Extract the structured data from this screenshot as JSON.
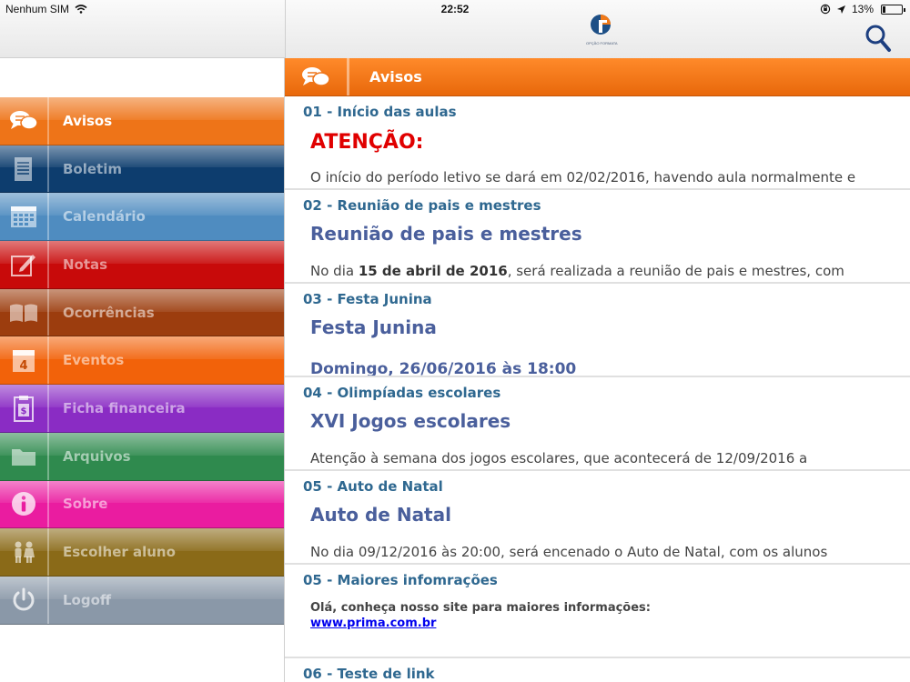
{
  "status_bar": {
    "carrier": "Nenhum SIM",
    "time": "22:52",
    "battery": "13%",
    "battery_level": 0.13
  },
  "app": {
    "logo_text": "OPÇÃO FORMATA"
  },
  "colors": {
    "avisos": "#ee7418",
    "boletim": "#0d3d6e",
    "calendario": "#4f8cc0",
    "notas": "#c80a0a",
    "ocorrencias": "#9c3d0e",
    "eventos": "#f2620a",
    "ficha": "#8a2cc4",
    "arquivos": "#2f8a4e",
    "sobre": "#ea1ca0",
    "escolher": "#8a6a18",
    "logoff": "#8a98a8"
  },
  "sidebar": {
    "items": [
      {
        "label": "Avisos",
        "icon": "chat-bubbles-icon"
      },
      {
        "label": "Boletim",
        "icon": "document-icon"
      },
      {
        "label": "Calendário",
        "icon": "calendar-grid-icon"
      },
      {
        "label": "Notas",
        "icon": "pencil-note-icon"
      },
      {
        "label": "Ocorrências",
        "icon": "open-book-icon"
      },
      {
        "label": "Eventos",
        "icon": "calendar-day-icon"
      },
      {
        "label": "Ficha financeira",
        "icon": "clipboard-dollar-icon"
      },
      {
        "label": "Arquivos",
        "icon": "folder-icon"
      },
      {
        "label": "Sobre",
        "icon": "info-icon"
      },
      {
        "label": "Escolher aluno",
        "icon": "children-icon"
      },
      {
        "label": "Logoff",
        "icon": "power-icon"
      }
    ]
  },
  "header": {
    "title": "Avisos"
  },
  "notices": [
    {
      "title": "01 - Início das aulas",
      "heading": "ATENÇÃO:",
      "body": "O início do período letivo se dará em 02/02/2016, havendo aula normalmente e"
    },
    {
      "title": "02 - Reunião de pais e mestres",
      "heading": "Reunião de pais e mestres",
      "body_prefix": "No dia ",
      "body_bold": "15 de abril de 2016",
      "body_suffix": ", será realizada a reunião de pais e mestres, com"
    },
    {
      "title": "03 - Festa Junina",
      "heading": "Festa Junina",
      "sub": "Domingo, 26/06/2016 às 18:00"
    },
    {
      "title": "04 - Olimpíadas escolares",
      "heading": "XVI Jogos escolares",
      "body": "Atenção à semana dos jogos escolares, que acontecerá de 12/09/2016 a"
    },
    {
      "title": "05 - Auto de Natal",
      "heading": "Auto de Natal",
      "body": "No dia 09/12/2016 às 20:00, será encenado o Auto de Natal, com os alunos"
    },
    {
      "title": "05 - Maiores infomrações",
      "text": "Olá, conheça nosso site para maiores informações:",
      "link": "www.prima.com.br"
    },
    {
      "title": "06 - Teste de link"
    }
  ]
}
